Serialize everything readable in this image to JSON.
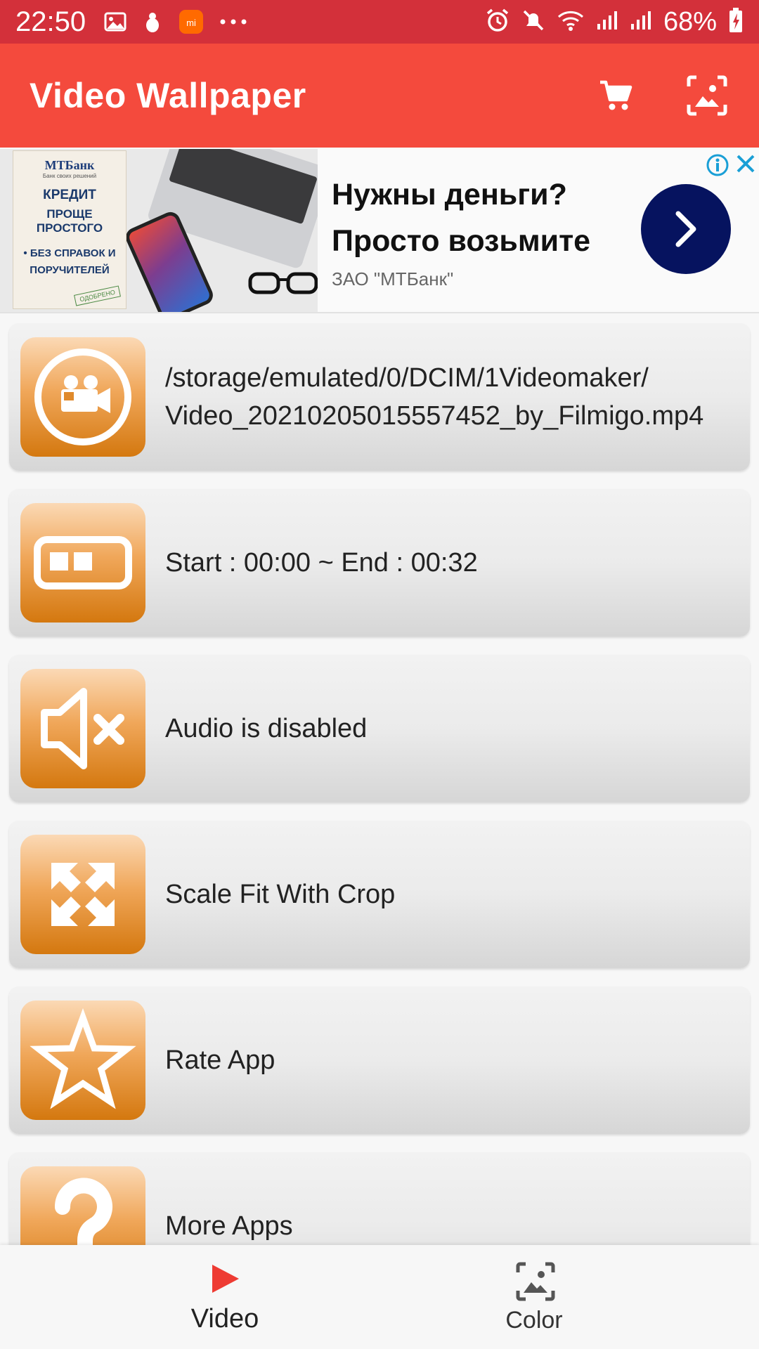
{
  "status_bar": {
    "time": "22:50",
    "battery": "68%",
    "icons": [
      "image-icon",
      "bug-icon",
      "mi-icon",
      "more-icon",
      "alarm-icon",
      "mute-icon",
      "wifi-icon",
      "signal-icon",
      "signal-icon",
      "battery-icon"
    ]
  },
  "app_bar": {
    "title": "Video Wallpaper",
    "actions": [
      "cart-icon",
      "wallpaper-preview-icon"
    ]
  },
  "ad": {
    "poster_brand": "МТБанк",
    "poster_tagline": "Банк своих решений",
    "poster_line1": "КРЕДИТ",
    "poster_line2": "ПРОЩЕ ПРОСТОГО",
    "poster_line3": "• БЕЗ СПРАВОК И",
    "poster_line4": "ПОРУЧИТЕЛЕЙ",
    "poster_stamp": "ОДОБРЕНО",
    "headline_line1": "Нужны деньги?",
    "headline_line2": "Просто возьмите",
    "advertiser": "ЗАО \"МТБанк\""
  },
  "menu": [
    {
      "icon": "video-camera-icon",
      "line1": "/storage/emulated/0/DCIM/1Videomaker/",
      "line2": "Video_20210205015557452_by_Filmigo.mp4"
    },
    {
      "icon": "trim-icon",
      "label": "Start : 00:00 ~ End : 00:32"
    },
    {
      "icon": "speaker-mute-icon",
      "label": "Audio is disabled"
    },
    {
      "icon": "expand-icon",
      "label": "Scale Fit With Crop"
    },
    {
      "icon": "star-icon",
      "label": "Rate App"
    },
    {
      "icon": "question-icon",
      "label": "More Apps"
    }
  ],
  "bottom_nav": {
    "video_label": "Video",
    "color_label": "Color",
    "active": "Video",
    "colors": {
      "active": "#ee3b33",
      "inactive": "#555555"
    }
  },
  "colors": {
    "status_bar": "#d3303a",
    "app_bar": "#f44a3d",
    "icon_orange": "#e08a2c",
    "ad_button": "#06135f"
  }
}
